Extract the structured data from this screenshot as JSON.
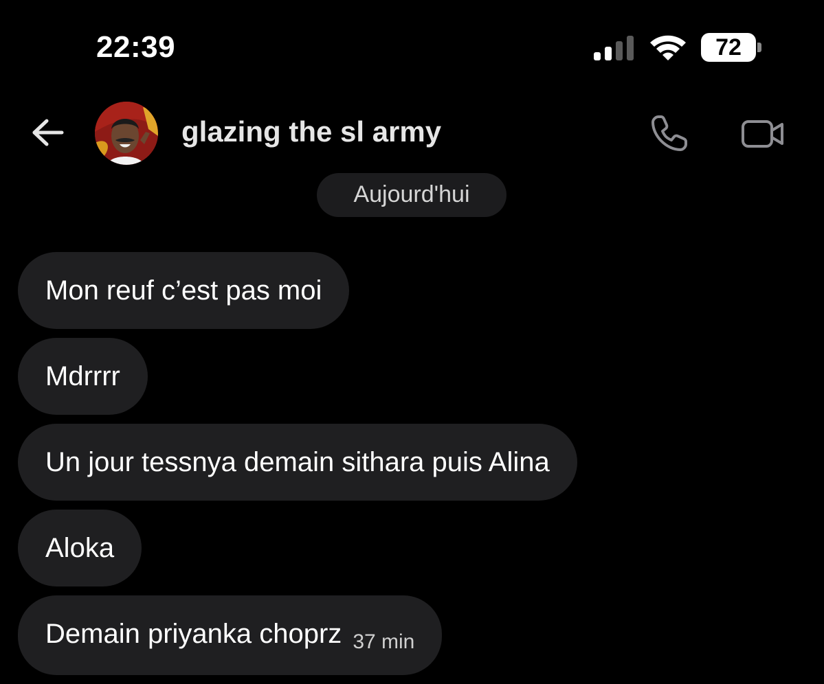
{
  "status_bar": {
    "time": "22:39",
    "battery": "72",
    "signal_icon": "cellular-signal-icon",
    "wifi_icon": "wifi-icon"
  },
  "header": {
    "title": "glazing the sl army",
    "back_icon": "arrow-left-icon",
    "call_icon": "phone-icon",
    "video_icon": "video-camera-icon"
  },
  "date_separator": "Aujourd'hui",
  "messages": [
    {
      "text": "Mon reuf c’est pas moi"
    },
    {
      "text": "Mdrrrr"
    },
    {
      "text": "Un jour tessnya demain sithara puis Alina"
    },
    {
      "text": "Aloka"
    },
    {
      "text": "Demain priyanka choprz",
      "time": "37 min"
    }
  ],
  "colors": {
    "background": "#000000",
    "bubble": "#1f1f21",
    "date_pill": "#1c1c1e",
    "header_icon": "#8e8e93"
  }
}
